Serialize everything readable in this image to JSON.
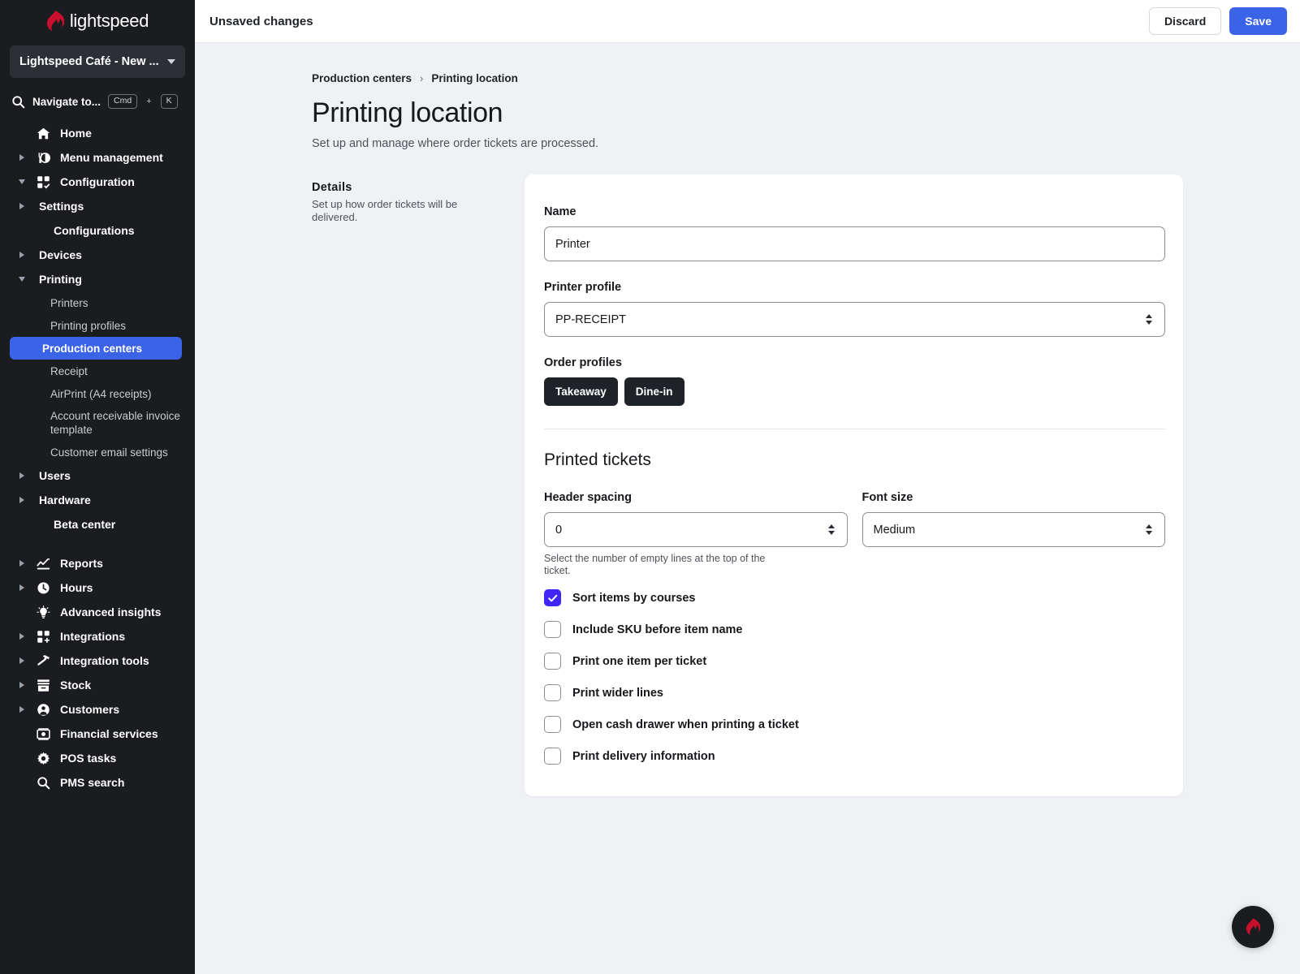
{
  "sidebar": {
    "brand": "lightspeed",
    "store": {
      "name": "Lightspeed Café - New ...",
      "caret": "chevron-down-icon"
    },
    "navigate": {
      "label": "Navigate to...",
      "key1": "Cmd",
      "plus": "+",
      "key2": "K"
    },
    "items": [
      {
        "label": "Home",
        "level": 1,
        "icon": "home-icon",
        "arrow": "none",
        "active": false
      },
      {
        "label": "Menu management",
        "level": 1,
        "icon": "menu-management-icon",
        "arrow": "right",
        "active": false
      },
      {
        "label": "Configuration",
        "level": 1,
        "icon": "configuration-icon",
        "arrow": "down",
        "active": false
      },
      {
        "label": "Settings",
        "level": 2,
        "icon": "none",
        "arrow": "right",
        "active": false
      },
      {
        "label": "Configurations",
        "level": 2,
        "icon": "none",
        "arrow": "none",
        "active": false
      },
      {
        "label": "Devices",
        "level": 2,
        "icon": "none",
        "arrow": "right",
        "active": false
      },
      {
        "label": "Printing",
        "level": 2,
        "icon": "none",
        "arrow": "down",
        "active": false
      },
      {
        "label": "Printers",
        "level": 3,
        "icon": "none",
        "arrow": "none",
        "active": false
      },
      {
        "label": "Printing profiles",
        "level": 3,
        "icon": "none",
        "arrow": "none",
        "active": false
      },
      {
        "label": "Production centers",
        "level": 3,
        "icon": "none",
        "arrow": "none",
        "active": true
      },
      {
        "label": "Receipt",
        "level": 3,
        "icon": "none",
        "arrow": "none",
        "active": false
      },
      {
        "label": "AirPrint (A4 receipts)",
        "level": 3,
        "icon": "none",
        "arrow": "none",
        "active": false
      },
      {
        "label": "Account receivable invoice template",
        "level": 3,
        "icon": "none",
        "arrow": "none",
        "active": false
      },
      {
        "label": "Customer email settings",
        "level": 3,
        "icon": "none",
        "arrow": "none",
        "active": false
      },
      {
        "label": "Users",
        "level": 2,
        "icon": "none",
        "arrow": "right",
        "active": false
      },
      {
        "label": "Hardware",
        "level": 2,
        "icon": "none",
        "arrow": "right",
        "active": false
      },
      {
        "label": "Beta center",
        "level": 2,
        "icon": "none",
        "arrow": "none",
        "active": false
      },
      {
        "label": "",
        "level": 0,
        "icon": "none",
        "arrow": "none",
        "active": false
      },
      {
        "label": "Reports",
        "level": 1,
        "icon": "reports-icon",
        "arrow": "right",
        "active": false
      },
      {
        "label": "Hours",
        "level": 1,
        "icon": "clock-icon",
        "arrow": "right",
        "active": false
      },
      {
        "label": "Advanced insights",
        "level": 1,
        "icon": "lightbulb-icon",
        "arrow": "none",
        "active": false
      },
      {
        "label": "Integrations",
        "level": 1,
        "icon": "integrations-icon",
        "arrow": "right",
        "active": false
      },
      {
        "label": "Integration tools",
        "level": 1,
        "icon": "hammer-icon",
        "arrow": "right",
        "active": false
      },
      {
        "label": "Stock",
        "level": 1,
        "icon": "stock-icon",
        "arrow": "right",
        "active": false
      },
      {
        "label": "Customers",
        "level": 1,
        "icon": "customers-icon",
        "arrow": "right",
        "active": false
      },
      {
        "label": "Financial services",
        "level": 1,
        "icon": "money-icon",
        "arrow": "none",
        "active": false
      },
      {
        "label": "POS tasks",
        "level": 1,
        "icon": "gear-icon",
        "arrow": "none",
        "active": false
      },
      {
        "label": "PMS search",
        "level": 1,
        "icon": "search-icon",
        "arrow": "none",
        "active": false
      }
    ]
  },
  "topbar": {
    "status": "Unsaved changes",
    "discard_label": "Discard",
    "save_label": "Save"
  },
  "page": {
    "breadcrumb": {
      "parent": "Production centers",
      "separator": "›",
      "current": "Printing location"
    },
    "title": "Printing location",
    "subtitle": "Set up and manage where order tickets are processed."
  },
  "details": {
    "aside_title": "Details",
    "aside_desc": "Set up how order tickets will be delivered.",
    "name": {
      "label": "Name",
      "value": "Printer",
      "placeholder": "Name"
    },
    "printer_profile": {
      "label": "Printer profile",
      "value": "PP-RECEIPT"
    },
    "order_profiles": {
      "label": "Order profiles",
      "chips": [
        "Takeaway",
        "Dine-in"
      ]
    }
  },
  "printed_tickets": {
    "heading": "Printed tickets",
    "header_spacing": {
      "label": "Header spacing",
      "value": "0",
      "help": "Select the number of empty lines at the top of the ticket."
    },
    "font_size": {
      "label": "Font size",
      "value": "Medium"
    },
    "checkboxes": [
      {
        "label": "Sort items by courses",
        "checked": true
      },
      {
        "label": "Include SKU before item name",
        "checked": false
      },
      {
        "label": "Print one item per ticket",
        "checked": false
      },
      {
        "label": "Print wider lines",
        "checked": false
      },
      {
        "label": "Open cash drawer when printing a ticket",
        "checked": false
      },
      {
        "label": "Print delivery information",
        "checked": false
      }
    ]
  },
  "fab": {
    "icon": "lightspeed-flame-icon"
  },
  "colors": {
    "sidebar_bg": "#1a1c1f",
    "accent_blue": "#3b63e8",
    "checkbox_checked": "#4026f5",
    "page_bg": "#eff1f5",
    "brand_red": "#c8102e"
  }
}
